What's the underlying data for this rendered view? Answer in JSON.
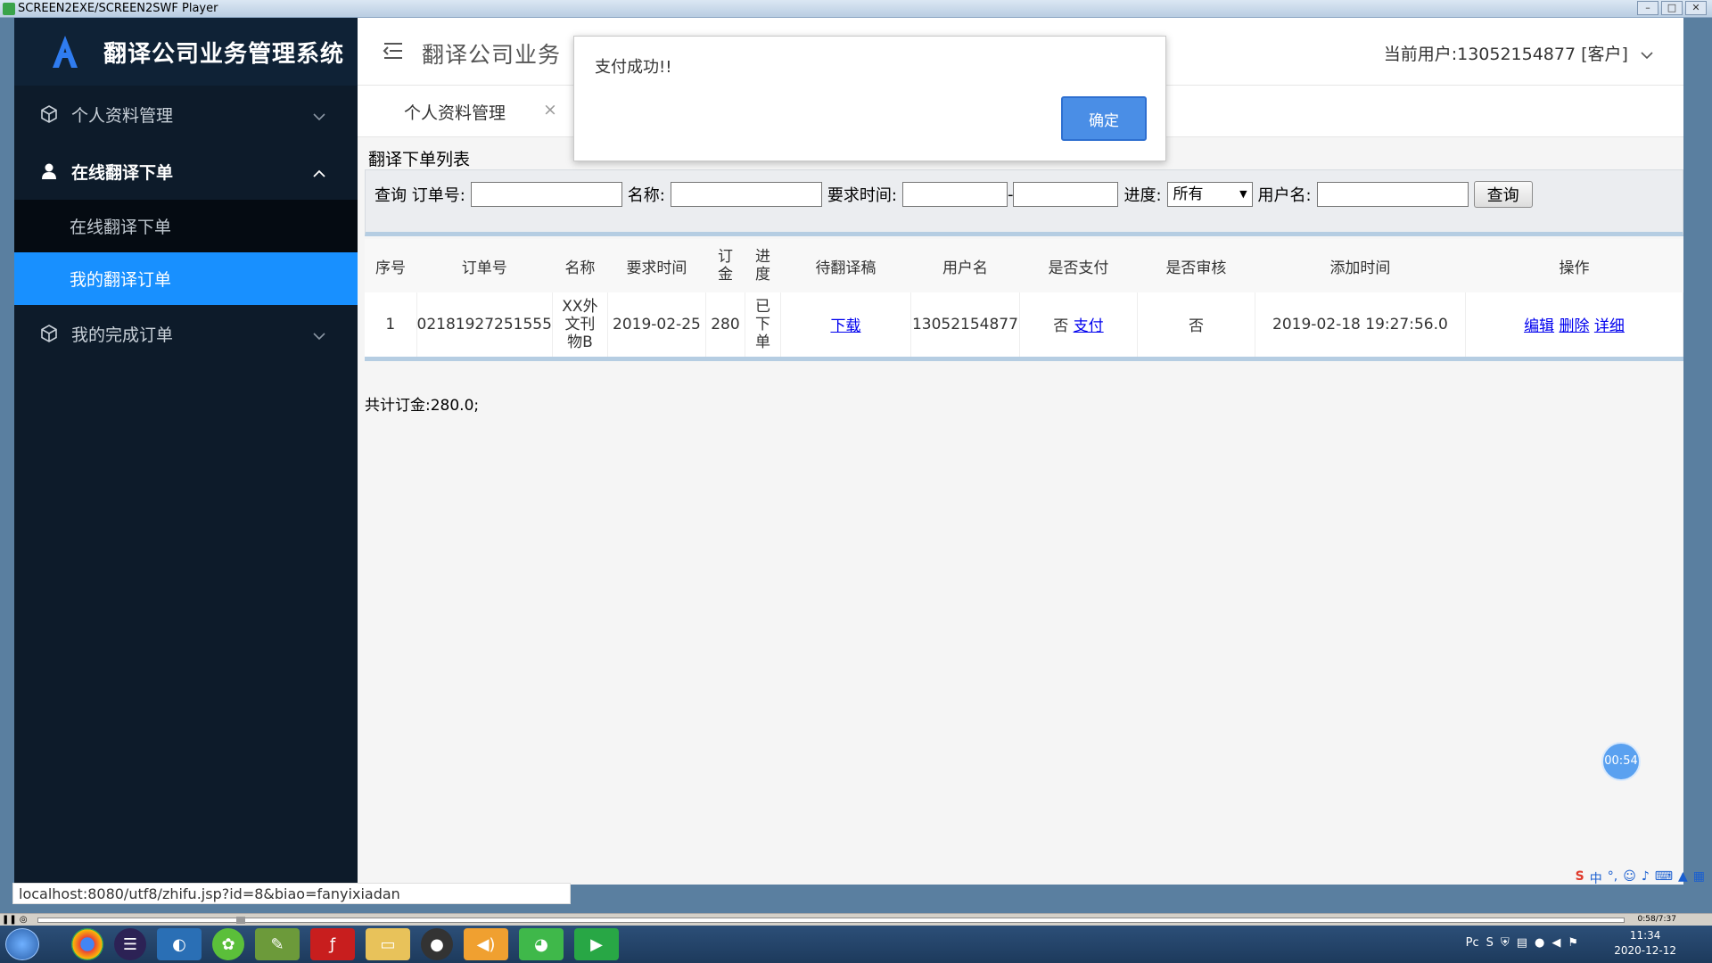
{
  "player": {
    "title": "SCREEN2EXE/SCREEN2SWF Player",
    "time": "0:58/7:37"
  },
  "app": {
    "brand_title": "翻译公司业务管理系统",
    "header_title": "翻译公司业务",
    "current_user": "当前用户:13052154877 [客户]"
  },
  "sidebar": {
    "items": [
      {
        "label": "个人资料管理"
      },
      {
        "label": "在线翻译下单"
      },
      {
        "label": "我的完成订单"
      }
    ],
    "sub_items": [
      {
        "label": "在线翻译下单"
      },
      {
        "label": "我的翻译订单"
      }
    ]
  },
  "tabs": [
    {
      "label": "个人资料管理",
      "close": "×"
    }
  ],
  "dialog": {
    "message": "支付成功!!",
    "ok_label": "确定"
  },
  "list": {
    "title": "翻译下单列表",
    "search": {
      "order_label": "查询 订单号:",
      "name_label": "名称:",
      "time_label": "要求时间:",
      "time_sep": "-",
      "progress_label": "进度:",
      "progress_value": "所有",
      "user_label": "用户名:",
      "query_button": "查询"
    },
    "headers": {
      "seq": "序号",
      "order_no": "订单号",
      "name": "名称",
      "req_time": "要求时间",
      "fee": "订金",
      "progress": "进度",
      "draft": "待翻译稿",
      "username": "用户名",
      "paid": "是否支付",
      "reviewed": "是否审核",
      "added": "添加时间",
      "ops": "操作"
    },
    "row": {
      "seq": "1",
      "order_no": "02181927251555",
      "name": "XX外文刊物B",
      "req_time": "2019-02-25",
      "fee": "280",
      "progress": "已下单",
      "draft_link": "下载",
      "username": "13052154877",
      "paid": "否",
      "pay_link": "支付",
      "reviewed": "否",
      "added": "2019-02-18 19:27:56.0",
      "edit": "编辑",
      "delete": "删除",
      "detail": "详细"
    },
    "total": "共计订金:280.0;"
  },
  "timer": "00:54",
  "status_url": "localhost:8080/utf8/zhifu.jsp?id=8&biao=fanyixiadan",
  "taskbar": {
    "time": "11:34",
    "date": "2020-12-12"
  },
  "ime": {
    "mode": "中"
  },
  "colors": {
    "sidebar_bg": "#0d1b2a",
    "active_item": "#1890ff",
    "ok_button": "#4a8ee6"
  }
}
